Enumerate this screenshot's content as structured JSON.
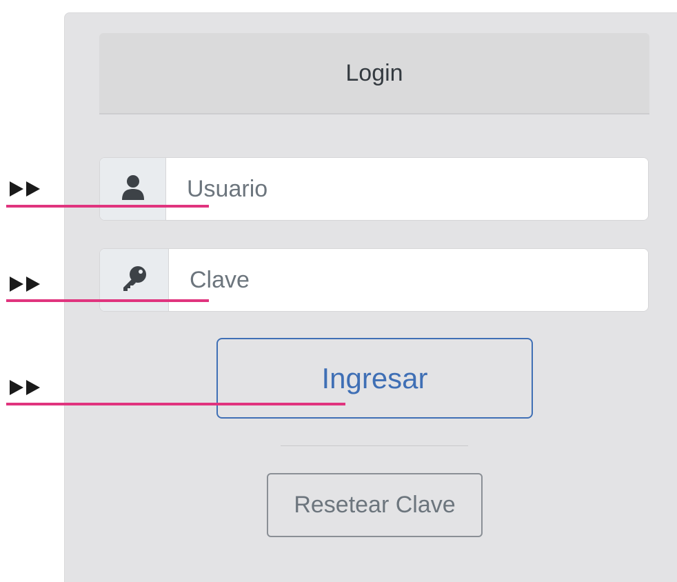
{
  "login": {
    "header_title": "Login",
    "username": {
      "placeholder": "Usuario",
      "icon": "user-icon"
    },
    "password": {
      "placeholder": "Clave",
      "icon": "key-icon"
    },
    "submit_label": "Ingresar",
    "reset_label": "Resetear Clave"
  },
  "annotations": {
    "marker_icon": "double-triangle-arrow",
    "line_color": "#e0347e",
    "marker_color": "#1a1a1a"
  },
  "colors": {
    "primary": "#3f6fb5",
    "secondary": "#6c757d",
    "panel_bg": "#e3e3e5",
    "header_bg": "#dadadb"
  }
}
